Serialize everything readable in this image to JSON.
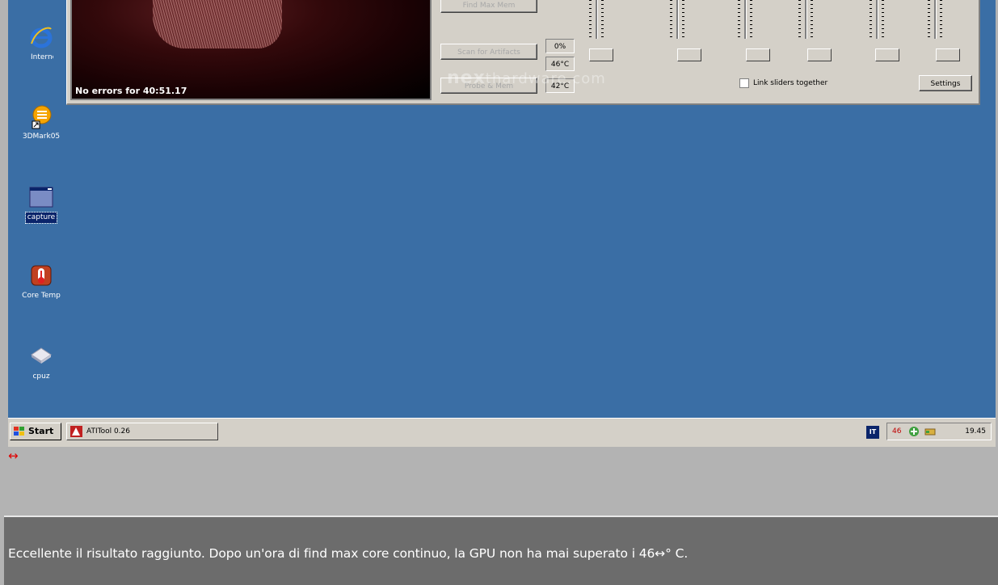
{
  "desktop": {
    "icons": [
      {
        "name": "internet-explorer",
        "label": "Interne Explore"
      },
      {
        "name": "3dmark05",
        "label": "3DMark05"
      },
      {
        "name": "capture",
        "label": "capture",
        "selected": true
      },
      {
        "name": "core-temp",
        "label": "Core Temp"
      },
      {
        "name": "cpuz",
        "label": "cpuz"
      }
    ],
    "background_color": "#3a6ea5"
  },
  "atitool": {
    "status": "No errors for 40:51.17",
    "buttons": {
      "find_max_mem": "Find Max Mem",
      "scan_artifacts": "Scan for Artifacts",
      "probe": "Probe & Mem",
      "settings": "Settings"
    },
    "readouts": {
      "load": "0%",
      "temp_1": "46°C",
      "temp_2": "42°C"
    },
    "link_sliders_label": "Link sliders together",
    "link_sliders_checked": false,
    "watermark": {
      "bold": "nex",
      "light": "thardware.com"
    }
  },
  "taskbar": {
    "start_label": "Start",
    "task_ati": "ATITool 0.26",
    "tray_app": "IT",
    "tray_temp": "46",
    "clock": "19.45"
  },
  "marker": "↔",
  "caption": "Eccellente il risultato raggiunto. Dopo un'ora di find max core continuo, la GPU non ha mai superato i 46↔° C."
}
